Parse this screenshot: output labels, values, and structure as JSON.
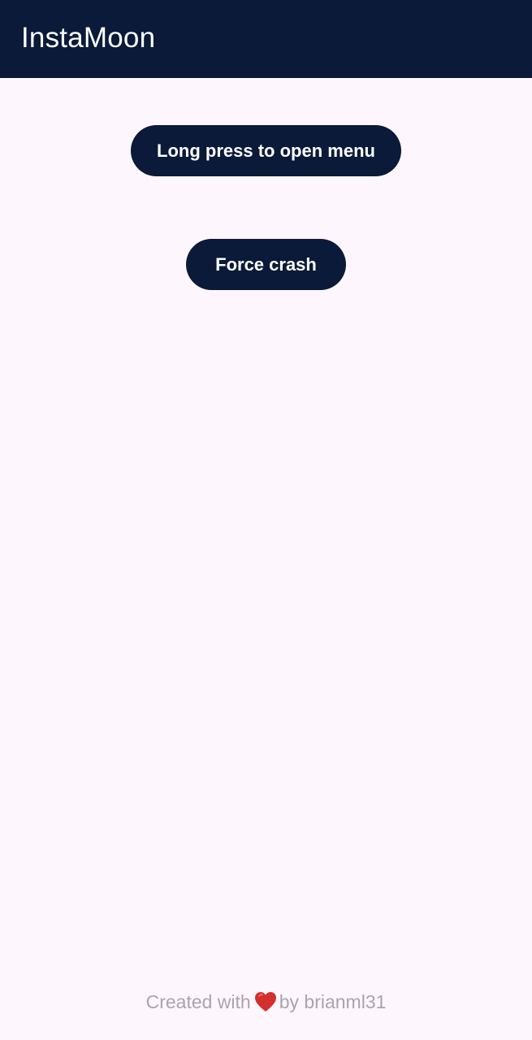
{
  "app_bar": {
    "title": "InstaMoon",
    "background_color": "#0a1a38"
  },
  "main": {
    "menu_button_label": "Long press to open menu",
    "crash_button_label": "Force crash",
    "button_color": "#0a1a38"
  },
  "footer": {
    "prefix": "Created with",
    "icon": "heart-icon",
    "icon_color": "#d32f2f",
    "suffix": "by brianml31"
  }
}
